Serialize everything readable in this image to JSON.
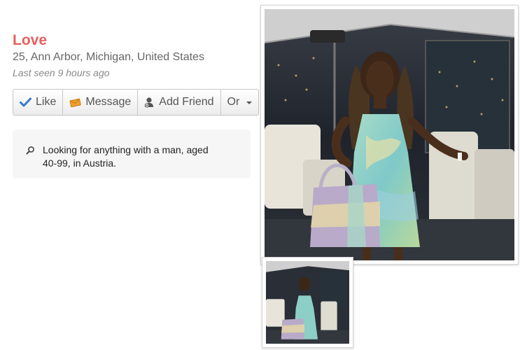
{
  "profile": {
    "name": "Love",
    "location": "25, Ann Arbor, Michigan, United States",
    "last_seen": "Last seen 9 hours ago"
  },
  "actions": {
    "like_label": "Like",
    "message_label": "Message",
    "add_friend_label": "Add Friend",
    "or_label": "Or"
  },
  "looking_for": {
    "icon": "search-icon",
    "text": "Looking for anything with a man, aged 40-99, in Austria."
  },
  "photos": {
    "main_alt": "Profile photo",
    "thumbnail_alt": "Profile photo thumbnail"
  },
  "colors": {
    "name": "#e85f5f",
    "like_check": "#3b78c8",
    "message_envelope": "#f0a030"
  }
}
